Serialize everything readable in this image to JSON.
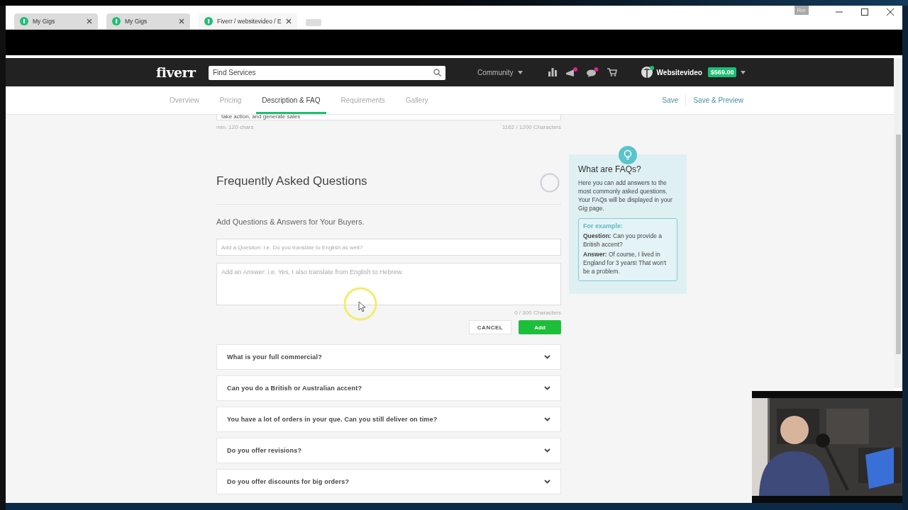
{
  "browser_tabs": [
    {
      "title": "My Gigs",
      "selected": false
    },
    {
      "title": "My Gigs",
      "selected": false
    },
    {
      "title": "Fiverr / websitevideo / E",
      "selected": true
    }
  ],
  "window_badge": "Rcr",
  "header": {
    "logo": "fiverr",
    "search_placeholder": "Find Services",
    "community": "Community",
    "username": "Websitevideo",
    "balance": "$569.00"
  },
  "nav": {
    "tabs": [
      {
        "label": "Overview",
        "selected": false
      },
      {
        "label": "Pricing",
        "selected": false
      },
      {
        "label": "Description & FAQ",
        "selected": true
      },
      {
        "label": "Requirements",
        "selected": false
      },
      {
        "label": "Gallery",
        "selected": false
      }
    ],
    "actions": [
      "Save",
      "Save & Preview"
    ]
  },
  "description": {
    "text_tail": "take action, and generate sales",
    "min_hint": "min. 120 chars",
    "count": "1162 / 1200 Characters"
  },
  "faq": {
    "title": "Frequently Asked Questions",
    "subtitle": "Add Questions & Answers for Your Buyers.",
    "question_placeholder": "Add a Question: i.e. Do you translate to English as well?",
    "answer_placeholder": "Add an Answer: i.e. Yes, I also translate from English to Hebrew.",
    "answer_count": "0 / 300 Characters",
    "cancel": "CANCEL",
    "add": "Add",
    "items": [
      {
        "question": "What is your full commercial?",
        "expanded": false
      },
      {
        "question": "Can you do a British or Australian accent?",
        "expanded": false
      },
      {
        "question": "You have a lot of orders in your que. Can you still deliver on time?",
        "expanded": false
      },
      {
        "question": "Do you offer revisions?",
        "expanded": false
      },
      {
        "question": "Do you offer discounts for big orders?",
        "expanded": false
      }
    ]
  },
  "tip": {
    "title": "What are FAQs?",
    "body": "Here you can add answers to the most commonly asked questions. Your FAQs will be displayed in your Gig page.",
    "example_title": "For example:",
    "example": [
      "**Question:** Can you provide a British accent?",
      "**Answer:** Of course, I lived in England for 3 years! That won't be a problem."
    ]
  }
}
